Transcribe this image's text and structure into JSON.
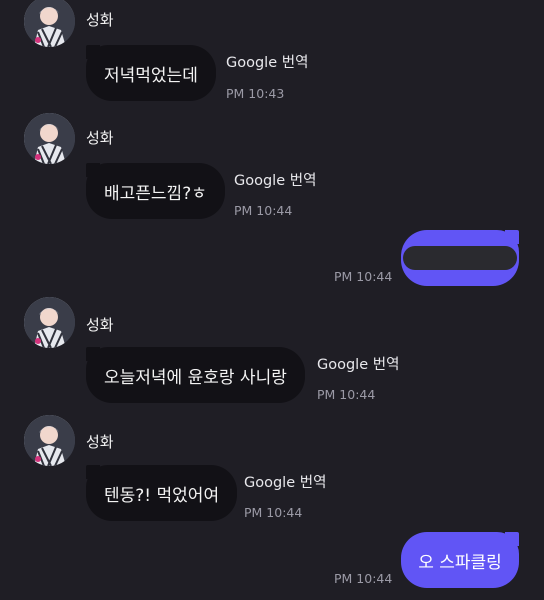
{
  "colors": {
    "background": "#1f1e25",
    "incoming_bubble": "#121116",
    "outgoing_bubble": "#6155f5",
    "timestamp": "#9b9aa6"
  },
  "messages": [
    {
      "sender": "성화",
      "text": "저녁먹었는데",
      "translate": "Google 번역",
      "time": "PM 10:43"
    },
    {
      "sender": "성화",
      "text": "배고픈느낌?ㅎ",
      "translate": "Google 번역",
      "time": "PM 10:44"
    },
    {
      "outgoing": true,
      "text": "",
      "redacted": true,
      "time": "PM 10:44"
    },
    {
      "sender": "성화",
      "text": "오늘저녁에 윤호랑 사니랑",
      "translate": "Google 번역",
      "time": "PM 10:44"
    },
    {
      "sender": "성화",
      "text": "텐동?! 먹었어여",
      "translate": "Google 번역",
      "time": "PM 10:44"
    },
    {
      "outgoing": true,
      "text": "오 스파클링",
      "time": "PM 10:44"
    }
  ]
}
